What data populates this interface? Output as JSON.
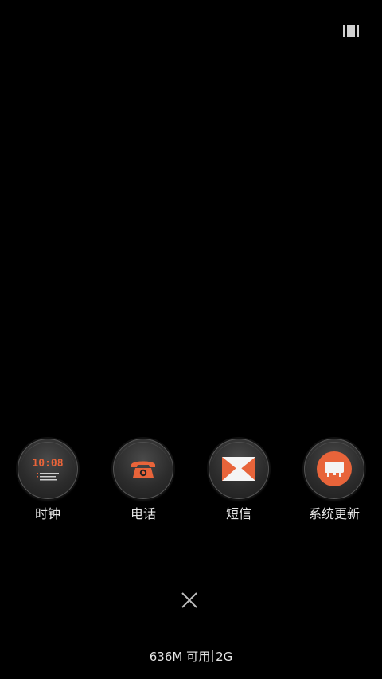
{
  "top_bar": {
    "toggle_icon": "recents-grid-icon"
  },
  "apps": [
    {
      "label": "时钟",
      "icon": "clock-icon",
      "clock_time": "10:08"
    },
    {
      "label": "电话",
      "icon": "phone-icon"
    },
    {
      "label": "短信",
      "icon": "envelope-icon"
    },
    {
      "label": "系统更新",
      "icon": "system-update-icon"
    }
  ],
  "bottom": {
    "close_icon": "close-icon",
    "memory_available": "636M 可用",
    "memory_total": "2G"
  },
  "colors": {
    "background": "#000000",
    "accent": "#e8643a",
    "label": "#e6e6e6"
  }
}
